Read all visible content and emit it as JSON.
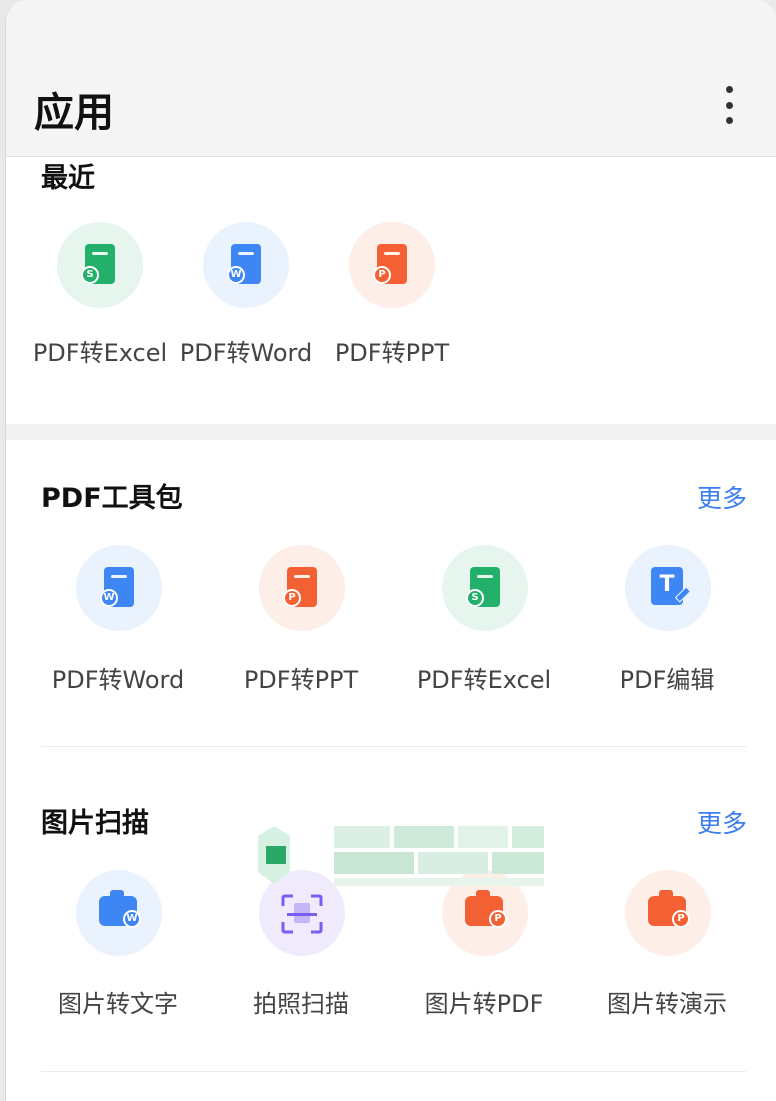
{
  "header": {
    "title": "应用"
  },
  "recent": {
    "title": "最近",
    "items": [
      {
        "label": "PDF转Excel",
        "icon": "pdf-to-excel-icon",
        "badge": "S"
      },
      {
        "label": "PDF转Word",
        "icon": "pdf-to-word-icon",
        "badge": "W"
      },
      {
        "label": "PDF转PPT",
        "icon": "pdf-to-ppt-icon",
        "badge": "P"
      }
    ]
  },
  "pdf_tools": {
    "title": "PDF工具包",
    "more": "更多",
    "items": [
      {
        "label": "PDF转Word",
        "icon": "pdf-to-word-icon",
        "badge": "W"
      },
      {
        "label": "PDF转PPT",
        "icon": "pdf-to-ppt-icon",
        "badge": "P"
      },
      {
        "label": "PDF转Excel",
        "icon": "pdf-to-excel-icon",
        "badge": "S"
      },
      {
        "label": "PDF编辑",
        "icon": "pdf-edit-icon",
        "badge": "T"
      }
    ]
  },
  "image_scan": {
    "title": "图片扫描",
    "more": "更多",
    "items": [
      {
        "label": "图片转文字",
        "icon": "image-to-text-icon",
        "badge": "W"
      },
      {
        "label": "拍照扫描",
        "icon": "photo-scan-icon"
      },
      {
        "label": "图片转PDF",
        "icon": "image-to-pdf-icon",
        "badge": "P"
      },
      {
        "label": "图片转演示",
        "icon": "image-to-slides-icon",
        "badge": "P"
      }
    ]
  },
  "colors": {
    "accent": "#3a7df0",
    "green": "#23b06b",
    "blue": "#3d86f3",
    "red": "#f26033",
    "purple": "#7b5cf0"
  }
}
